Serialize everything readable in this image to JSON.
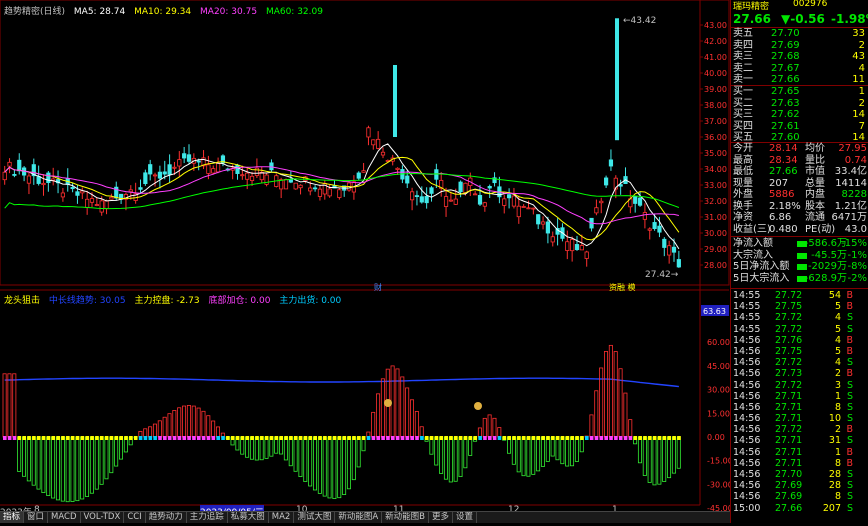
{
  "chart_header": {
    "title": "趋势精密(日线)",
    "ma": [
      {
        "label": "MA5: 28.74",
        "color": "#ffffff"
      },
      {
        "label": "MA10: 29.34",
        "color": "#ffff00"
      },
      {
        "label": "MA20: 30.75",
        "color": "#ff40ff"
      },
      {
        "label": "MA60: 32.09",
        "color": "#00ff00"
      }
    ]
  },
  "indicator": {
    "name": "龙头狙击",
    "items": [
      {
        "label": "中长线趋势: 30.05",
        "color": "#2244ff"
      },
      {
        "label": "主力控盘: -2.73",
        "color": "#ffff00"
      },
      {
        "label": "底部加仓: 0.00",
        "color": "#ff40ff"
      },
      {
        "label": "主力出货: 0.00",
        "color": "#00ccff"
      }
    ],
    "value_tag": "63.63",
    "yticks": [
      "60.00",
      "45.00",
      "30.00",
      "15.00",
      "0.00",
      "-15.00",
      "-30.00",
      "-45.00"
    ]
  },
  "price_axis": [
    "43.00",
    "42.00",
    "41.00",
    "40.00",
    "39.00",
    "38.00",
    "37.00",
    "36.00",
    "35.00",
    "34.00",
    "33.00",
    "32.00",
    "31.00",
    "30.00",
    "29.00",
    "28.00"
  ],
  "annotations": {
    "high": "43.42",
    "low": "27.42",
    "tag1": "财",
    "tag2": "融",
    "tag3": "资融 模"
  },
  "x_labels": [
    {
      "text": "2023年",
      "x": 0
    },
    {
      "text": "8",
      "x": 34
    },
    {
      "text": "2023/09/05/二",
      "x": 200
    },
    {
      "text": "10",
      "x": 296
    },
    {
      "text": "11",
      "x": 393
    },
    {
      "text": "12",
      "x": 508
    },
    {
      "text": "1",
      "x": 612
    }
  ],
  "tabs": [
    "指标",
    "窗口",
    "MACD",
    "VOL-TDX",
    "CCI",
    "趋势动力",
    "主力追踪",
    "私募大图",
    "MA2",
    "测试大图",
    "新动能图A",
    "新动能图B",
    "更多",
    "设置"
  ],
  "stock": {
    "code": "002976",
    "name": "瑞玛精密",
    "price": "27.66",
    "change": "▼-0.56",
    "pct": "-1.98%"
  },
  "order_book": {
    "asks": [
      {
        "label": "卖五",
        "price": "27.70",
        "vol": "33"
      },
      {
        "label": "卖四",
        "price": "27.69",
        "vol": "2"
      },
      {
        "label": "卖三",
        "price": "27.68",
        "vol": "43"
      },
      {
        "label": "卖二",
        "price": "27.67",
        "vol": "4"
      },
      {
        "label": "卖一",
        "price": "27.66",
        "vol": "11"
      }
    ],
    "bids": [
      {
        "label": "买一",
        "price": "27.65",
        "vol": "1"
      },
      {
        "label": "买二",
        "price": "27.63",
        "vol": "2"
      },
      {
        "label": "买三",
        "price": "27.62",
        "vol": "14"
      },
      {
        "label": "买四",
        "price": "27.61",
        "vol": "7"
      },
      {
        "label": "买五",
        "price": "27.60",
        "vol": "14"
      }
    ]
  },
  "stats": [
    {
      "l1": "今开",
      "v1": "28.14",
      "l2": "均价",
      "v2": "27.95",
      "c1": "rd",
      "c2": "rd"
    },
    {
      "l1": "最高",
      "v1": "28.34",
      "l2": "量比",
      "v2": "0.74",
      "c1": "rd",
      "c2": "rd"
    },
    {
      "l1": "最低",
      "v1": "27.66",
      "l2": "市值",
      "v2": "33.4亿",
      "c1": "g",
      "c2": "w"
    },
    {
      "l1": "现量",
      "v1": "207",
      "l2": "总量",
      "v2": "14114",
      "c1": "w",
      "c2": "w"
    },
    {
      "l1": "外盘",
      "v1": "5886",
      "l2": "内盘",
      "v2": "8228",
      "c1": "rd",
      "c2": "g"
    },
    {
      "l1": "换手",
      "v1": "2.18%",
      "l2": "股本",
      "v2": "1.21亿",
      "c1": "w",
      "c2": "w"
    },
    {
      "l1": "净资",
      "v1": "6.86",
      "l2": "流通",
      "v2": "6471万",
      "c1": "w",
      "c2": "w"
    },
    {
      "l1": "收益(三)",
      "v1": "0.480",
      "l2": "PE(动)",
      "v2": "43.0",
      "c1": "w",
      "c2": "w"
    }
  ],
  "flows": [
    {
      "label": "净流入额",
      "value": "-586.6万",
      "pct": "-15%"
    },
    {
      "label": "大宗流入",
      "value": "-45.5万",
      "pct": "-1%"
    },
    {
      "label": "5日净流入额",
      "value": "-2029万",
      "pct": "-8%"
    },
    {
      "label": "5日大宗流入",
      "value": "-628.9万",
      "pct": "-2%"
    }
  ],
  "ticks": [
    {
      "t": "14:55",
      "p": "27.72",
      "v": "54",
      "s": "B"
    },
    {
      "t": "14:55",
      "p": "27.75",
      "v": "5",
      "s": "B"
    },
    {
      "t": "14:55",
      "p": "27.72",
      "v": "4",
      "s": "S"
    },
    {
      "t": "14:55",
      "p": "27.72",
      "v": "5",
      "s": "S"
    },
    {
      "t": "14:56",
      "p": "27.76",
      "v": "4",
      "s": "B"
    },
    {
      "t": "14:56",
      "p": "27.75",
      "v": "5",
      "s": "B"
    },
    {
      "t": "14:56",
      "p": "27.72",
      "v": "4",
      "s": "S"
    },
    {
      "t": "14:56",
      "p": "27.73",
      "v": "2",
      "s": "B"
    },
    {
      "t": "14:56",
      "p": "27.72",
      "v": "3",
      "s": "S"
    },
    {
      "t": "14:56",
      "p": "27.71",
      "v": "1",
      "s": "S"
    },
    {
      "t": "14:56",
      "p": "27.71",
      "v": "8",
      "s": "S"
    },
    {
      "t": "14:56",
      "p": "27.71",
      "v": "10",
      "s": "S"
    },
    {
      "t": "14:56",
      "p": "27.72",
      "v": "2",
      "s": "B"
    },
    {
      "t": "14:56",
      "p": "27.71",
      "v": "31",
      "s": "S"
    },
    {
      "t": "14:56",
      "p": "27.71",
      "v": "1",
      "s": "B"
    },
    {
      "t": "14:56",
      "p": "27.71",
      "v": "8",
      "s": "B"
    },
    {
      "t": "14:56",
      "p": "27.70",
      "v": "28",
      "s": "S"
    },
    {
      "t": "14:56",
      "p": "27.69",
      "v": "28",
      "s": "S"
    },
    {
      "t": "14:56",
      "p": "27.69",
      "v": "8",
      "s": "S"
    },
    {
      "t": "15:00",
      "p": "27.66",
      "v": "207",
      "s": "S"
    }
  ],
  "colors": {
    "up": "#ff3030",
    "down": "#3fe8e8",
    "ma5": "#ffffff",
    "ma10": "#ffff00",
    "ma20": "#ff40ff",
    "ma60": "#00ff00",
    "trend": "#2244ff"
  }
}
